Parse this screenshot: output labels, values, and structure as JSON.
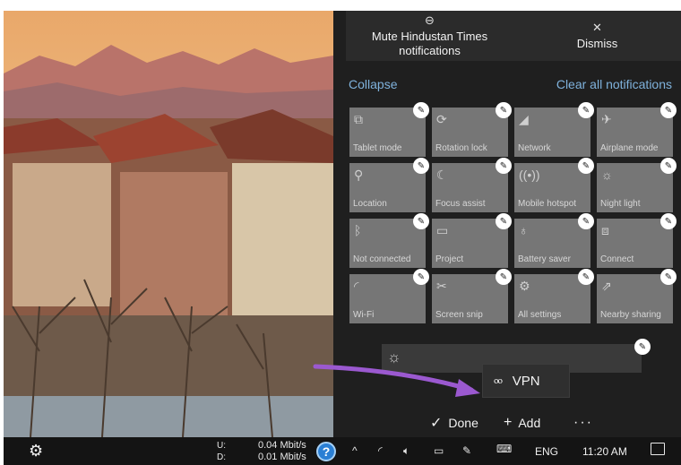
{
  "notification": {
    "mute_label": "Mute Hindustan Times notifications",
    "mute_icon": "minus-circle-icon",
    "dismiss_label": "Dismiss",
    "dismiss_icon": "close-icon"
  },
  "collapse_label": "Collapse",
  "clear_all_label": "Clear all notifications",
  "tiles": [
    {
      "label": "Tablet mode",
      "icon": "tablet-mode-icon"
    },
    {
      "label": "Rotation lock",
      "icon": "rotation-lock-icon"
    },
    {
      "label": "Network",
      "icon": "network-icon"
    },
    {
      "label": "Airplane mode",
      "icon": "airplane-icon"
    },
    {
      "label": "Location",
      "icon": "location-icon"
    },
    {
      "label": "Focus assist",
      "icon": "moon-icon"
    },
    {
      "label": "Mobile hotspot",
      "icon": "hotspot-icon"
    },
    {
      "label": "Night light",
      "icon": "night-light-icon"
    },
    {
      "label": "Not connected",
      "icon": "bluetooth-icon"
    },
    {
      "label": "Project",
      "icon": "project-icon"
    },
    {
      "label": "Battery saver",
      "icon": "battery-saver-icon"
    },
    {
      "label": "Connect",
      "icon": "connect-icon"
    },
    {
      "label": "Wi-Fi",
      "icon": "wifi-icon"
    },
    {
      "label": "Screen snip",
      "icon": "screen-snip-icon"
    },
    {
      "label": "All settings",
      "icon": "settings-icon"
    },
    {
      "label": "Nearby sharing",
      "icon": "nearby-sharing-icon"
    }
  ],
  "vpn_label": "VPN",
  "done_label": "Done",
  "add_label": "Add",
  "taskbar": {
    "upload_label": "U:",
    "download_label": "D:",
    "upload_speed": "0.04 Mbit/s",
    "download_speed": "0.01 Mbit/s",
    "language": "ENG",
    "time": "11:20 AM"
  },
  "colors": {
    "accent_link": "#7fb2dc",
    "tile_bg": "#767676",
    "panel_bg": "#1f1f1f",
    "arrow": "#9b59d0"
  }
}
